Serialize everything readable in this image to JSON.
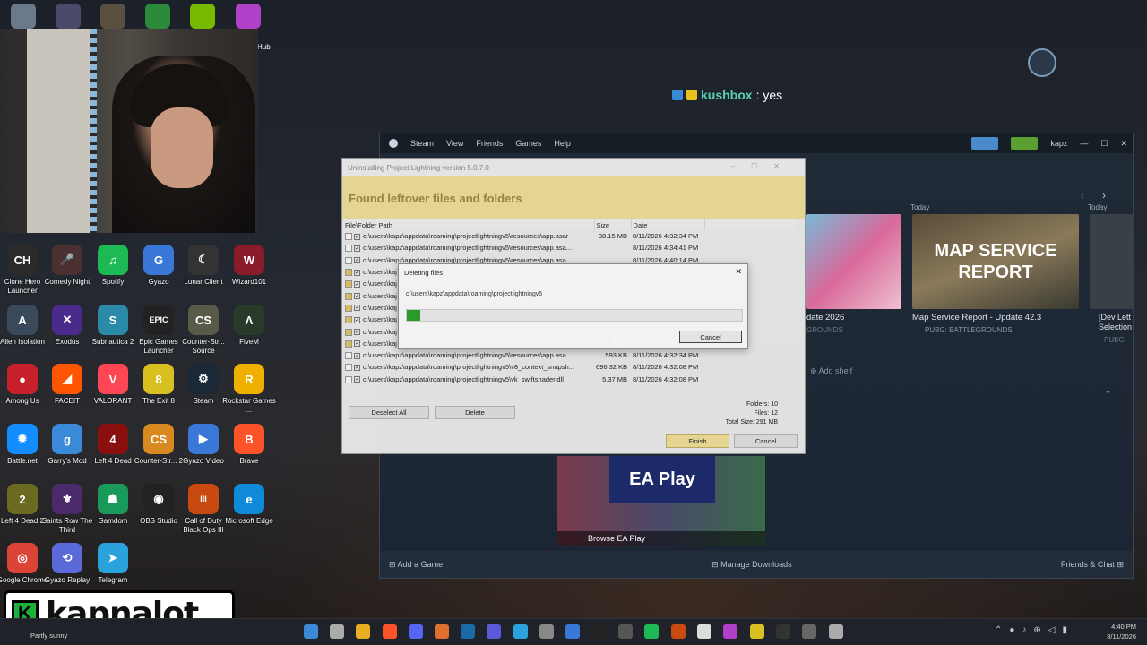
{
  "chat": {
    "username": "kushbox",
    "message": ": yes"
  },
  "overlay": {
    "logo_letter": "K",
    "channel_name": "kapnalot"
  },
  "desktop_icons": [
    {
      "label": "Clone Hero Launcher",
      "glyph": "CH",
      "color": "#2a2a2a"
    },
    {
      "label": "Comedy Night",
      "glyph": "🎤",
      "color": "#4a3030"
    },
    {
      "label": "Spotify",
      "glyph": "♫",
      "color": "#1db954"
    },
    {
      "label": "Gyazo",
      "glyph": "G",
      "color": "#3a78d8"
    },
    {
      "label": "Lunar Client",
      "glyph": "☾",
      "color": "#333"
    },
    {
      "label": "Wizard101",
      "glyph": "W",
      "color": "#8a1c2a"
    },
    {
      "label": "Alien Isolation",
      "glyph": "A",
      "color": "#3a4a5a"
    },
    {
      "label": "Exodus",
      "glyph": "✕",
      "color": "#4a2a8a"
    },
    {
      "label": "Subnautica 2",
      "glyph": "S",
      "color": "#2a8aa8"
    },
    {
      "label": "Epic Games Launcher",
      "glyph": "EPIC",
      "color": "#222"
    },
    {
      "label": "Counter-Str... Source",
      "glyph": "CS",
      "color": "#5a5a4a"
    },
    {
      "label": "FiveM",
      "glyph": "Λ",
      "color": "#2a3a2a"
    },
    {
      "label": "Among Us",
      "glyph": "●",
      "color": "#c8202a"
    },
    {
      "label": "FACEIT",
      "glyph": "◢",
      "color": "#ff5500"
    },
    {
      "label": "VALORANT",
      "glyph": "V",
      "color": "#ff4655"
    },
    {
      "label": "The Exit 8",
      "glyph": "8",
      "color": "#d8c020"
    },
    {
      "label": "Steam",
      "glyph": "⚙",
      "color": "#1b2838"
    },
    {
      "label": "Rockstar Games ...",
      "glyph": "R",
      "color": "#f0b000"
    },
    {
      "label": "Battle.net",
      "glyph": "✹",
      "color": "#148eff"
    },
    {
      "label": "Garry's Mod",
      "glyph": "g",
      "color": "#3a8ad8"
    },
    {
      "label": "Left 4 Dead",
      "glyph": "4",
      "color": "#8a1010"
    },
    {
      "label": "Counter-Str... 2",
      "glyph": "CS",
      "color": "#d88a20"
    },
    {
      "label": "Gyazo Video",
      "glyph": "▶",
      "color": "#3a78d8"
    },
    {
      "label": "Brave",
      "glyph": "B",
      "color": "#fb542b"
    },
    {
      "label": "Left 4 Dead 2",
      "glyph": "2",
      "color": "#6a6a20"
    },
    {
      "label": "Saints Row The Third",
      "glyph": "⚜",
      "color": "#4a2a6a"
    },
    {
      "label": "Gamdom",
      "glyph": "☗",
      "color": "#1a9a5a"
    },
    {
      "label": "OBS Studio",
      "glyph": "◉",
      "color": "#222"
    },
    {
      "label": "Call of Duty Black Ops III",
      "glyph": "III",
      "color": "#c84a10"
    },
    {
      "label": "Microsoft Edge",
      "glyph": "e",
      "color": "#0f8ad8"
    },
    {
      "label": "Google Chrome",
      "glyph": "◎",
      "color": "#db4437"
    },
    {
      "label": "Gyazo Replay",
      "glyph": "⟲",
      "color": "#5a6ad8"
    },
    {
      "label": "Telegram",
      "glyph": "➤",
      "color": "#2aa3dc"
    }
  ],
  "top_partial_label": "Hub",
  "steam": {
    "menu": [
      "Steam",
      "View",
      "Friends",
      "Games",
      "Help"
    ],
    "username": "kapz",
    "cards": [
      {
        "caption": "date 2026",
        "sub": "GROUNDS"
      },
      {
        "caption": "Map Service Report - Update 42.3",
        "sub": "PUBG: BATTLEGROUNDS",
        "art": "MAP SERVICE REPORT"
      },
      {
        "caption": "[Dev Lett Selection",
        "sub": "PUBG"
      }
    ],
    "today_labels": [
      "Today",
      "Today"
    ],
    "add_shelf": "Add shelf",
    "ea_play": {
      "title": "EA Play",
      "button": "Browse EA Play"
    },
    "bottom": {
      "add_game": "Add a Game",
      "manage_downloads": "Manage Downloads",
      "friends_chat": "Friends & Chat"
    }
  },
  "uninstaller": {
    "title": "Uninstalling Project Lightning version 5.0.7.0",
    "banner": "Found leftover files and folders",
    "columns": [
      "File\\Folder Path",
      "Size",
      "Date"
    ],
    "rows": [
      {
        "path": "c:\\users\\kapz\\appdata\\roaming\\projectlightningv5\\resources\\app.asar",
        "size": "38.15 MB",
        "date": "8/11/2026 4:32:34 PM"
      },
      {
        "path": "c:\\users\\kapz\\appdata\\roaming\\projectlightningv5\\resources\\app.asa...",
        "size": "",
        "date": "8/11/2026 4:34:41 PM"
      },
      {
        "path": "c:\\users\\kapz\\appdata\\roaming\\projectlightningv5\\resources\\app.asa...",
        "size": "",
        "date": "8/11/2026 4:40:14 PM"
      },
      {
        "path": "c:\\users\\kaj",
        "size": "",
        "date": ""
      },
      {
        "path": "c:\\users\\kaj",
        "size": "",
        "date": ""
      },
      {
        "path": "c:\\users\\kaj",
        "size": "",
        "date": ""
      },
      {
        "path": "c:\\users\\kaj",
        "size": "",
        "date": ""
      },
      {
        "path": "c:\\users\\kaj",
        "size": "",
        "date": ""
      },
      {
        "path": "c:\\users\\kaj",
        "size": "",
        "date": ""
      },
      {
        "path": "c:\\users\\kaj",
        "size": "",
        "date": ""
      },
      {
        "path": "c:\\users\\kapz\\appdata\\roaming\\projectlightningv5\\resources\\app.asa...",
        "size": "593 KB",
        "date": "8/11/2026 4:32:34 PM"
      },
      {
        "path": "c:\\users\\kapz\\appdata\\roaming\\projectlightningv5\\v8_context_snapsh...",
        "size": "696.32 KB",
        "date": "8/11/2026 4:32:08 PM"
      },
      {
        "path": "c:\\users\\kapz\\appdata\\roaming\\projectlightningv5\\vk_swiftshader.dll",
        "size": "5.37 MB",
        "date": "8/11/2026 4:32:08 PM"
      }
    ],
    "deselect_all": "Deselect All",
    "delete": "Delete",
    "summary": {
      "folders_label": "Folders:",
      "folders": "10",
      "files_label": "Files:",
      "files": "12",
      "total_label": "Total Size:",
      "total": "291 MB"
    },
    "finish": "Finish",
    "cancel": "Cancel"
  },
  "deleting": {
    "title": "Deleting files",
    "path": "c:\\users\\kapz\\appdata\\roaming\\projectlightningv5",
    "progress": 0.04,
    "progress_color": "#2a9a2a",
    "cancel": "Cancel"
  },
  "taskbar": {
    "weather": "Partly sunny",
    "time": "4:40 PM",
    "date": "8/11/2026"
  }
}
